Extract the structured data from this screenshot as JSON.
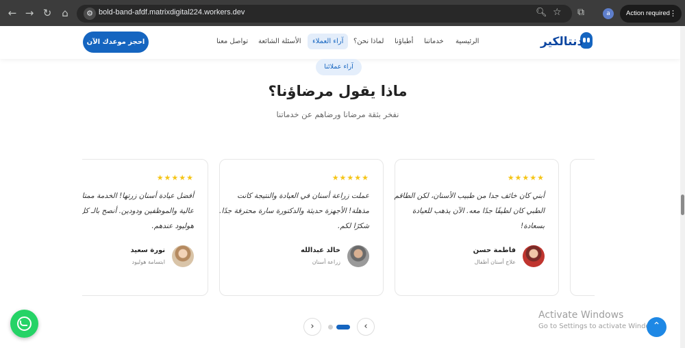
{
  "browser": {
    "url": "bold-band-afdf.matrixdigital224.workers.dev",
    "profile_initial": "a",
    "action_label": "Action required",
    "icons": [
      "back-arrow-icon",
      "forward-arrow-icon",
      "reload-icon",
      "home-icon",
      "site-settings-icon",
      "zoom-icon",
      "star-icon",
      "extensions-icon",
      "more-vert-icon"
    ]
  },
  "nav": {
    "logo": "دنتالكير",
    "links": [
      "الرئيسية",
      "خدماتنا",
      "أطباؤنا",
      "لماذا نحن؟",
      "آراء العملاء",
      "الأسئلة الشائعة",
      "تواصل معنا"
    ],
    "active_link": "آراء العملاء",
    "cta": "احجز موعدك الآن"
  },
  "section": {
    "badge": "آراء عملائنا",
    "title": "ماذا يقول مرضاؤنا؟",
    "subtitle": "نفخر بثقة مرضانا ورضاهم عن خدماتنا"
  },
  "testimonials": [
    {
      "stars": "★★★★★",
      "quote": "أبني كان خائف جدا من طبيب الأسنان، لكن الطاقم الطبي كان لطيفًا جدًا معه. الآن يذهب للعيادة بسعادة!",
      "name": "فاطمة حسن",
      "role": "علاج أسنان أطفال"
    },
    {
      "stars": "★★★★★",
      "quote": "عملت زراعة أسنان في العيادة والنتيجة كانت مذهلة! الأجهزة حديثة والدكتورة سارة محترفة جدًا. شكرًا لكم.",
      "name": "خالد عبدالله",
      "role": "زراعة أسنان"
    },
    {
      "stars": "★★★★★",
      "quote": "أفضل عيادة أسنان زرتها! الخدمة ممتازة والنظافة عالية والموظفين ودودين. أنصح بالـ كل لهاوية هوليود عندهم.",
      "name": "نورة سعيد",
      "role": "ابتسامة هوليود"
    }
  ],
  "carousel": {
    "prev": "‹",
    "next": "›",
    "active_index": 1
  },
  "windows_watermark": {
    "title": "Activate Windows",
    "subtitle": "Go to Settings to activate Windows."
  },
  "colors": {
    "primary": "#1565c0",
    "whatsapp": "#25d366",
    "star": "#f5c518"
  }
}
